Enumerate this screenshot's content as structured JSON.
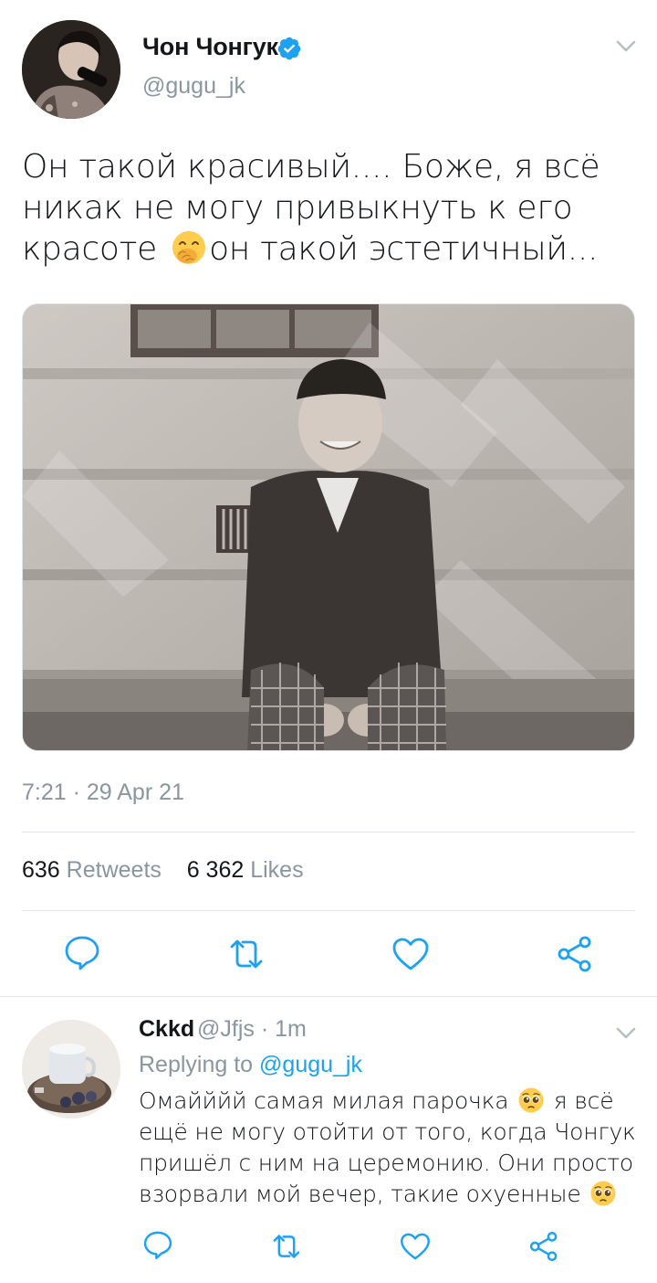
{
  "tweet": {
    "author_name": "Чон Чонгук",
    "author_handle": "@gugu_jk",
    "text_part1": "Он такой красивый.... Боже, я всё никак не могу привыкнуть к его красоте ",
    "text_part2": "он такой эстетичный...",
    "emoji": "hand-over-mouth-emoji",
    "timestamp": "7:21 · 29 Apr 21",
    "retweets_count": "636",
    "retweets_label": "Retweets",
    "likes_count": "6 362",
    "likes_label": "Likes",
    "icons": [
      "comment-icon",
      "retweet-icon",
      "like-icon",
      "share-icon"
    ]
  },
  "reply": {
    "author_name": "Ckkd",
    "author_handle": "@Jfjs",
    "time": "· 1m",
    "replying_prefix": "Replying to",
    "replying_to": "@gugu_jk",
    "text_part1": "Омайййй самая милая парочка ",
    "text_part2": " я всё ещё не могу отойти от того, когда Чонгук пришёл с ним на церемонию. Они просто взорвали мой вечер, такие охуенные ",
    "emoji": "pleading-face-emoji"
  },
  "colors": {
    "text": "#14171a",
    "secondary": "#8a969f",
    "accent": "#1da1f2",
    "divider": "#dfe5ea",
    "icon": "#1da1f2"
  }
}
